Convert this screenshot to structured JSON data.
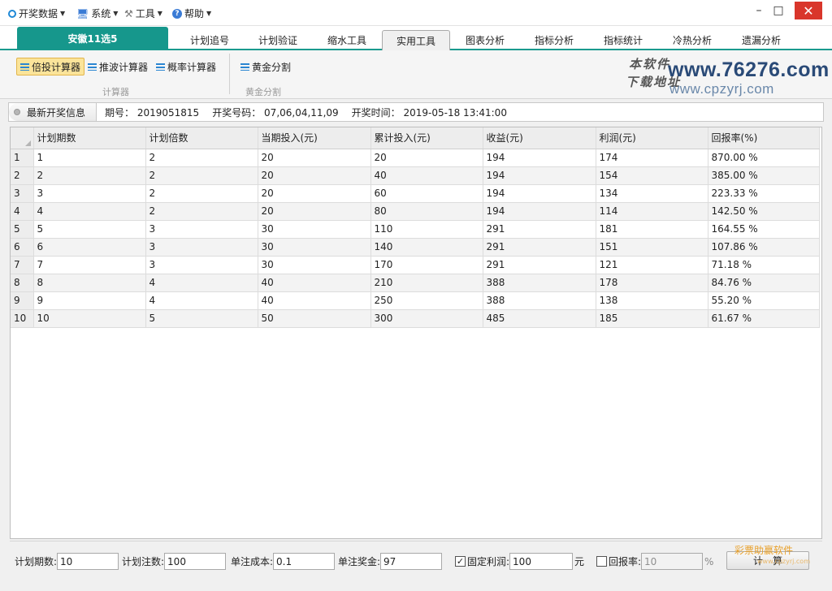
{
  "menu": {
    "items": [
      {
        "label": "开奖数据",
        "icon": "circle-icon"
      },
      {
        "label": "系统",
        "icon": "monitor-icon"
      },
      {
        "label": "工具",
        "icon": "wrench-icon"
      },
      {
        "label": "帮助",
        "icon": "help-icon"
      }
    ]
  },
  "window_controls": {
    "minimize": "–",
    "maximize": "□",
    "close": "✕"
  },
  "lottery_tab": "安徽11选5",
  "nav_tabs": [
    {
      "label": "计划追号"
    },
    {
      "label": "计划验证"
    },
    {
      "label": "缩水工具"
    },
    {
      "label": "实用工具",
      "active": true
    },
    {
      "label": "图表分析"
    },
    {
      "label": "指标分析"
    },
    {
      "label": "指标统计"
    },
    {
      "label": "冷热分析"
    },
    {
      "label": "遗漏分析"
    }
  ],
  "ribbon": {
    "calculators": [
      {
        "label": "倍投计算器",
        "active": true
      },
      {
        "label": "推波计算器"
      },
      {
        "label": "概率计算器"
      }
    ],
    "group1_label": "计算器",
    "golden_button": "黄金分割",
    "group2_label": "黄金分割",
    "watermark_script_line1": "本软件",
    "watermark_script_line2": "下载地址",
    "watermark_url": "www.76276.com",
    "watermark_url2": "www.cpzyrj.com"
  },
  "info_bar": {
    "button_label": "最新开奖信息",
    "issue_label": "期号：",
    "issue_value": "2019051815",
    "numbers_label": "开奖号码：",
    "numbers_value": "07,06,04,11,09",
    "time_label": "开奖时间：",
    "time_value": "2019-05-18 13:41:00"
  },
  "table": {
    "headers": [
      "计划期数",
      "计划倍数",
      "当期投入(元)",
      "累计投入(元)",
      "收益(元)",
      "利润(元)",
      "回报率(%)"
    ],
    "rows": [
      [
        "1",
        "2",
        "20",
        "20",
        "194",
        "174",
        "870.00 %"
      ],
      [
        "2",
        "2",
        "20",
        "40",
        "194",
        "154",
        "385.00 %"
      ],
      [
        "3",
        "2",
        "20",
        "60",
        "194",
        "134",
        "223.33 %"
      ],
      [
        "4",
        "2",
        "20",
        "80",
        "194",
        "114",
        "142.50 %"
      ],
      [
        "5",
        "3",
        "30",
        "110",
        "291",
        "181",
        "164.55 %"
      ],
      [
        "6",
        "3",
        "30",
        "140",
        "291",
        "151",
        "107.86 %"
      ],
      [
        "7",
        "3",
        "30",
        "170",
        "291",
        "121",
        "71.18 %"
      ],
      [
        "8",
        "4",
        "40",
        "210",
        "388",
        "178",
        "84.76 %"
      ],
      [
        "9",
        "4",
        "40",
        "250",
        "388",
        "138",
        "55.20 %"
      ],
      [
        "10",
        "5",
        "50",
        "300",
        "485",
        "185",
        "61.67 %"
      ]
    ]
  },
  "form": {
    "periods_label": "计划期数:",
    "periods_value": "10",
    "bets_label": "计划注数:",
    "bets_value": "100",
    "cost_label": "单注成本:",
    "cost_value": "0.1",
    "prize_label": "单注奖金:",
    "prize_value": "97",
    "fixed_profit_label": "固定利润:",
    "fixed_profit_checked": true,
    "fixed_profit_value": "100",
    "fixed_profit_unit": "元",
    "return_rate_label": "回报率:",
    "return_rate_checked": false,
    "return_rate_value": "10",
    "return_rate_unit": "%",
    "calc_button": "计算",
    "calc_watermark": "彩票助赢软件",
    "calc_watermark_url": "www.cpzyrj.com"
  }
}
